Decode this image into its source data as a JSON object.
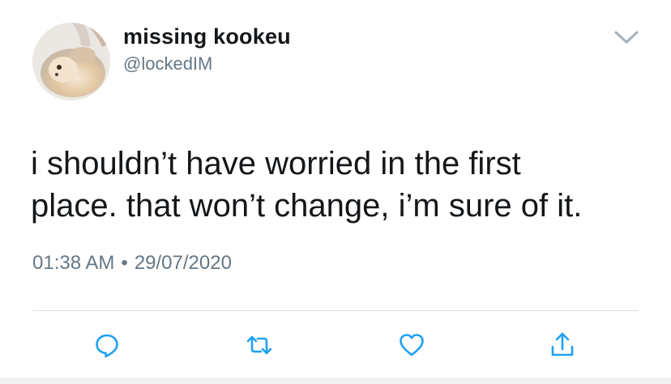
{
  "tweet": {
    "user": {
      "display_name": "missing kookeu",
      "handle": "@lockedIM",
      "avatar_icon": "profile-photo"
    },
    "text": "i shouldn’t have worried in the first\nplace. that won’t change, i’m sure of it.",
    "time": "01:38 AM",
    "separator": "•",
    "date": "29/07/2020"
  },
  "actions": {
    "reply_icon": "reply-icon",
    "retweet_icon": "retweet-icon",
    "like_icon": "heart-icon",
    "share_icon": "share-icon",
    "menu_icon": "chevron-down-icon"
  },
  "colors": {
    "text": "#14171a",
    "secondary": "#657786",
    "accent": "#1da1f2",
    "divider": "#d8dde0"
  }
}
